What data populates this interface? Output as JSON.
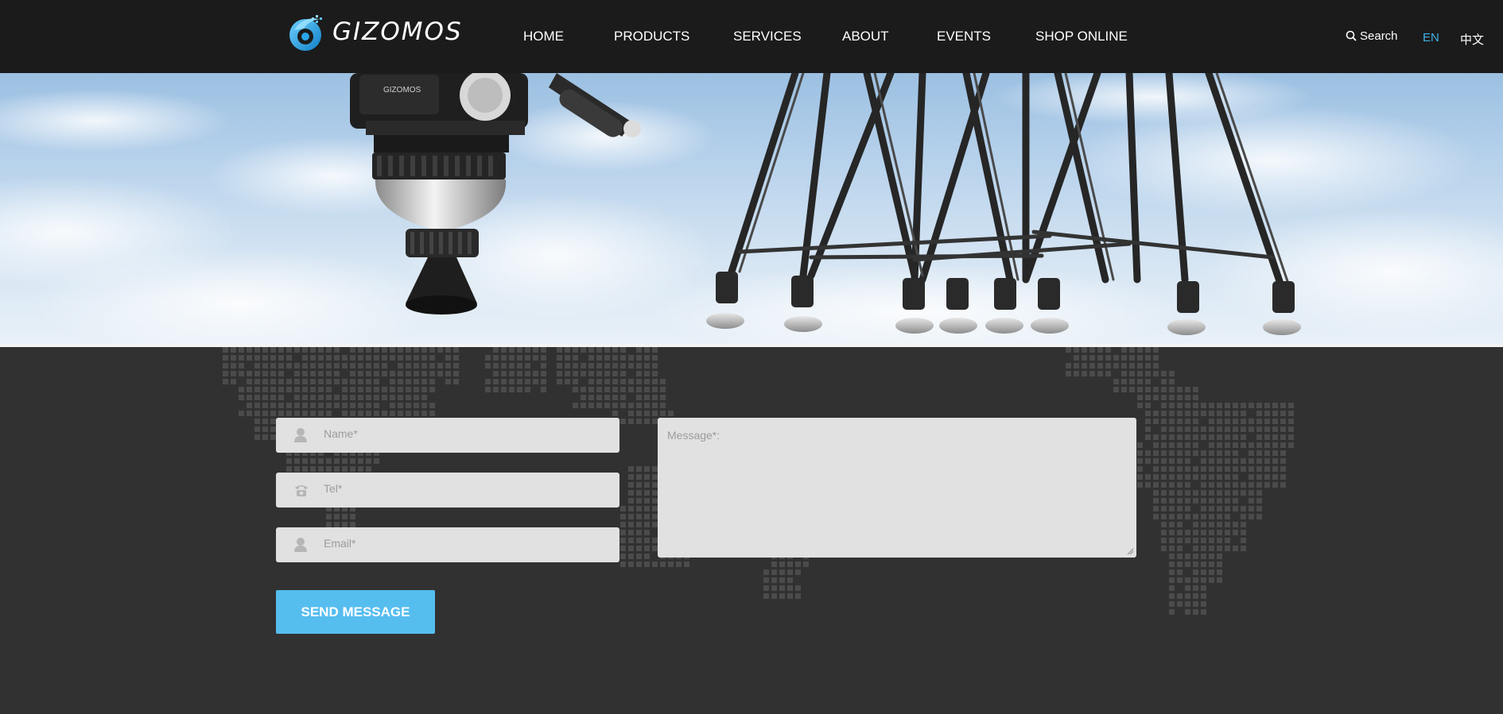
{
  "header": {
    "brand": "GIZOMOS",
    "nav": [
      "HOME",
      "PRODUCTS",
      "SERVICES",
      "ABOUT",
      "EVENTS",
      "SHOP ONLINE"
    ],
    "search_label": "Search",
    "lang_en": "EN",
    "lang_cn": "中文",
    "accent_color": "#3fb2ea"
  },
  "hero": {
    "image": "camera fluid head and carbon tripods against cloudy sky",
    "head_label": "GIZOMOS"
  },
  "contact_form": {
    "name_placeholder": "Name*",
    "tel_placeholder": "Tel*",
    "email_placeholder": "Email*",
    "message_placeholder": "Message*:",
    "send_label": "SEND MESSAGE",
    "button_color": "#56bdef",
    "icons": [
      "user-icon",
      "phone-icon",
      "user-icon"
    ]
  }
}
